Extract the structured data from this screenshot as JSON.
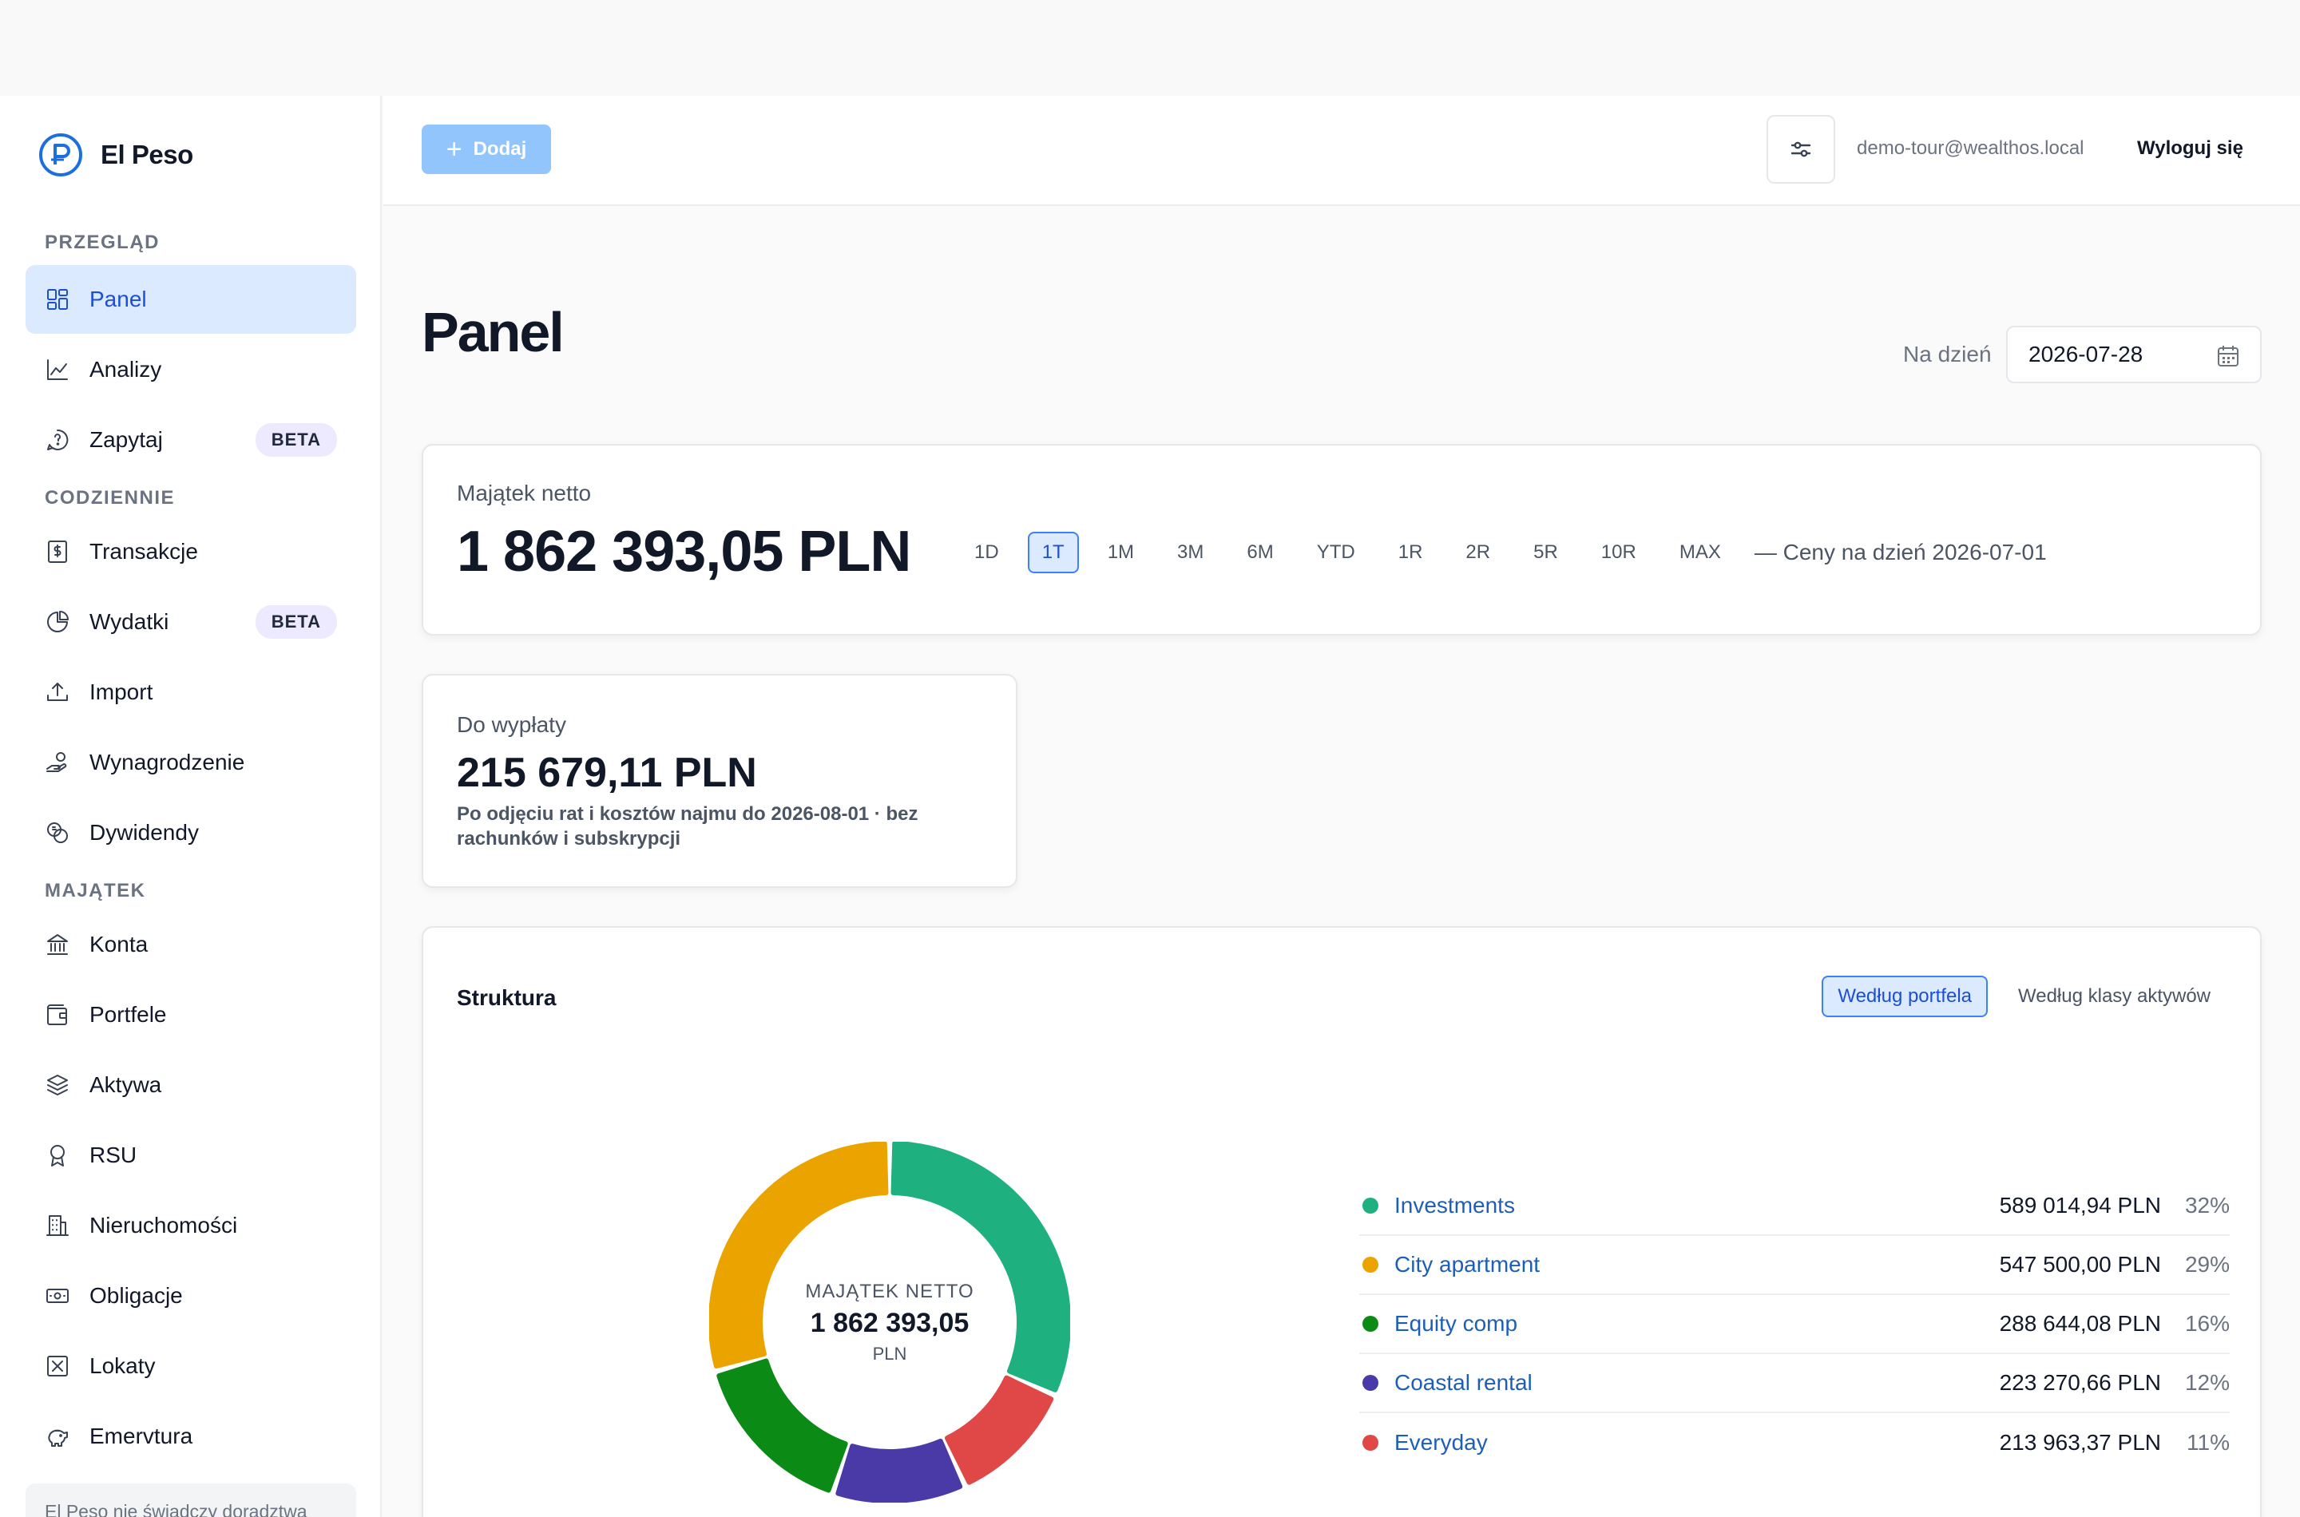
{
  "app": {
    "name": "El Peso"
  },
  "sidebar": {
    "sections": [
      {
        "label": "PRZEGLĄD",
        "items": [
          {
            "label": "Panel",
            "icon": "dashboard-icon",
            "active": true
          },
          {
            "label": "Analizy",
            "icon": "chart-line-icon"
          },
          {
            "label": "Zapytaj",
            "icon": "chat-question-icon",
            "badge": "BETA"
          }
        ]
      },
      {
        "label": "CODZIENNIE",
        "items": [
          {
            "label": "Transakcje",
            "icon": "dollar-receipt-icon"
          },
          {
            "label": "Wydatki",
            "icon": "pie-chart-icon",
            "badge": "BETA"
          },
          {
            "label": "Import",
            "icon": "upload-icon"
          },
          {
            "label": "Wynagrodzenie",
            "icon": "salary-hand-icon"
          },
          {
            "label": "Dywidendy",
            "icon": "coins-icon"
          }
        ]
      },
      {
        "label": "MAJĄTEK",
        "items": [
          {
            "label": "Konta",
            "icon": "bank-icon"
          },
          {
            "label": "Portfele",
            "icon": "wallet-icon"
          },
          {
            "label": "Aktywa",
            "icon": "layers-icon"
          },
          {
            "label": "RSU",
            "icon": "award-icon"
          },
          {
            "label": "Nieruchomości",
            "icon": "building-icon"
          },
          {
            "label": "Obligacje",
            "icon": "banknote-icon"
          },
          {
            "label": "Lokaty",
            "icon": "lock-box-icon"
          },
          {
            "label": "Emervtura",
            "icon": "piggy-bank-icon"
          }
        ]
      }
    ],
    "footer": "El Peso nie świadczy doradztwa"
  },
  "header": {
    "add_label": "Dodaj",
    "user_email": "demo-tour@wealthos.local",
    "logout_label": "Wyloguj się"
  },
  "page": {
    "title": "Panel",
    "date_label": "Na dzień",
    "date_value": "2026-07-28"
  },
  "net_worth": {
    "label": "Majątek netto",
    "value": "1 862 393,05 PLN",
    "ranges": [
      "1D",
      "1T",
      "1M",
      "3M",
      "6M",
      "YTD",
      "1R",
      "2R",
      "5R",
      "10R",
      "MAX"
    ],
    "active_range": "1T",
    "prices_note": "— Ceny na dzień 2026-07-01"
  },
  "payout": {
    "label": "Do wypłaty",
    "value": "215 679,11 PLN",
    "note": "Po odjęciu rat i kosztów najmu do 2026-08-01 · bez rachunków i subskrypcji"
  },
  "structure": {
    "title": "Struktura",
    "tabs": [
      "Według portfela",
      "Według klasy aktywów"
    ],
    "active_tab": "Według portfela",
    "center_label": "MAJĄTEK NETTO",
    "center_value": "1 862 393,05",
    "center_currency": "PLN"
  },
  "chart_data": {
    "type": "pie",
    "categories": [
      "Investments",
      "City apartment",
      "Equity comp",
      "Coastal rental",
      "Everyday"
    ],
    "values": [
      589014.94,
      547500.0,
      288644.08,
      223270.66,
      213963.37
    ],
    "value_labels": [
      "589 014,94 PLN",
      "547 500,00 PLN",
      "288 644,08 PLN",
      "223 270,66 PLN",
      "213 963,37 PLN"
    ],
    "percent_labels": [
      "32%",
      "29%",
      "16%",
      "12%",
      "11%"
    ],
    "colors": [
      "#1fb07f",
      "#eba300",
      "#0b8a16",
      "#4a3aa8",
      "#e04848"
    ],
    "donut_order": [
      "Investments",
      "Everyday",
      "Coastal rental",
      "Equity comp",
      "City apartment"
    ]
  }
}
